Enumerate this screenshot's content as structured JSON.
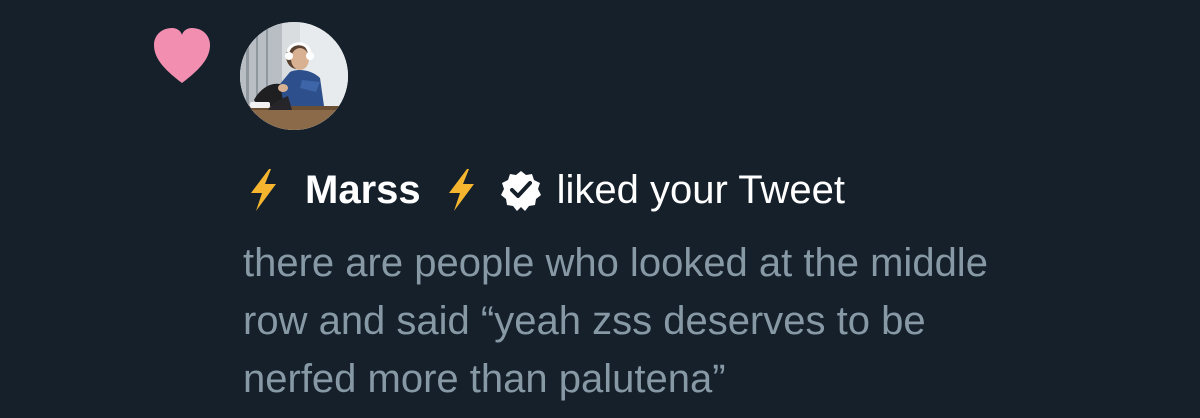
{
  "notification": {
    "type_icon": "heart-icon",
    "avatar_icon": "avatar-photo",
    "user_prefix_icon": "lightning-bolt-icon",
    "user_name": "Marss",
    "user_suffix_icon": "lightning-bolt-icon",
    "verified_icon": "verified-badge-icon",
    "action": "liked your Tweet",
    "tweet_text": "there are people who looked at the middle\nrow and said “yeah zss deserves to be\nnerfed more than palutena”"
  },
  "colors": {
    "background": "#15202b",
    "heart": "#f28fb1",
    "headline": "#ffffff",
    "tweet_text": "#8899a6",
    "bolt": "#f5b52f"
  }
}
